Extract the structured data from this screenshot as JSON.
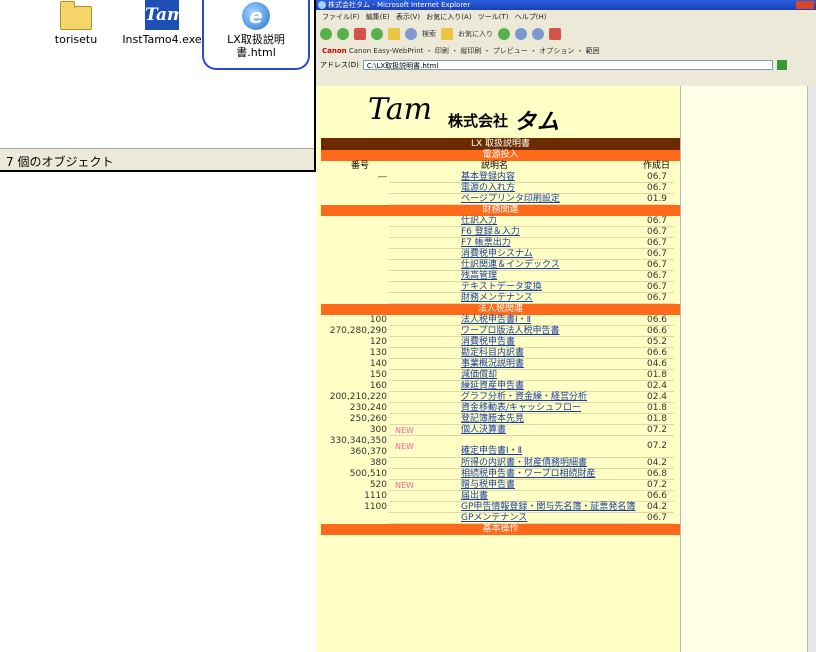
{
  "folder": {
    "icons": [
      {
        "label": "torisetu",
        "icon": "folder-icon"
      },
      {
        "label": "InstTamo4.exe",
        "icon": "tam-app-icon"
      },
      {
        "label": "LX取扱説明\n書.html",
        "icon": "ie-html-icon"
      }
    ],
    "status": "7 個のオブジェクト"
  },
  "browser": {
    "title": "株式会社タム - Microsoft Internet Explorer",
    "menu": "ファイル(F) 編集(E) 表示(V) お気に入り(A) ツール(T) ヘルプ(H)",
    "toolbar_search": "検索",
    "toolbar_favorites": "お気に入り",
    "canon_bar": "Canon Easy-WebPrint ・ 印刷 ・ 縦印刷 ・ プレビュー ・ オプション ・ 範囲",
    "address_label": "アドレス(D)",
    "address": "C:\\LX取扱説明書.html"
  },
  "page": {
    "logo_text": "am",
    "logo_company": "株式会社",
    "logo_name": "タム",
    "doc_title": "LX 取扱説明書",
    "col_number": "番号",
    "col_name": "説明名",
    "col_date": "作成日",
    "new_badge": "NEW",
    "sections": [
      {
        "title": "電源投入",
        "rows": [
          {
            "num": "―",
            "name": "基本登録内容",
            "date": "06.7"
          },
          {
            "num": "",
            "name": "電源の入れ方",
            "date": "06.7"
          },
          {
            "num": "",
            "name": "ページプリンタ印刷設定",
            "date": "01.9"
          }
        ]
      },
      {
        "title": "財務関連",
        "rows": [
          {
            "num": "",
            "name": "仕訳入力",
            "date": "06.7"
          },
          {
            "num": "",
            "name": "F6 登録＆入力",
            "date": "06.7"
          },
          {
            "num": "",
            "name": "F7 帳票出力",
            "date": "06.7"
          },
          {
            "num": "",
            "name": "消費税申シスナム",
            "date": "06.7"
          },
          {
            "num": "",
            "name": "仕訳関連＆インデックス",
            "date": "06.7"
          },
          {
            "num": "",
            "name": "残高管理",
            "date": "06.7"
          },
          {
            "num": "",
            "name": "テキストデータ変換",
            "date": "06.7"
          },
          {
            "num": "",
            "name": "財務メンテナンス",
            "date": "06.7"
          }
        ]
      },
      {
        "title": "法人税関連",
        "rows": [
          {
            "num": "100",
            "name": "法人税申告書Ⅰ・Ⅱ",
            "date": "06.6"
          },
          {
            "num": "270,280,290",
            "name": "ワープロ版法人税申告書",
            "date": "06.6"
          },
          {
            "num": "120",
            "name": "消費税申告書",
            "date": "05.2"
          },
          {
            "num": "130",
            "name": "勘定科目内訳書",
            "date": "06.6"
          },
          {
            "num": "140",
            "name": "事業概況説明書",
            "date": "04.6"
          },
          {
            "num": "150",
            "name": "減価償却",
            "date": "01.8"
          },
          {
            "num": "160",
            "name": "繰延資産申告書",
            "date": "02.4"
          },
          {
            "num": "200,210,220",
            "name": "グラフ分析・資金繰・経営分析",
            "date": "02.4"
          },
          {
            "num": "230,240",
            "name": "資金移動表/キャッシュフロー",
            "date": "01.8"
          },
          {
            "num": "250,260",
            "name": "登記簿謄本先見",
            "date": "01.8"
          },
          {
            "num": "300",
            "name": "個人決算書",
            "date": "07.2",
            "new": true
          },
          {
            "num": "330,340,350\n360,370",
            "name": "確定申告書Ⅰ・Ⅱ",
            "date": "07.2",
            "new": true,
            "tall": true
          },
          {
            "num": "380",
            "name": "所得の内訳書・財産債務明細書",
            "date": "04.2"
          },
          {
            "num": "500,510",
            "name": "相続税申告書・ワープロ相続財産",
            "date": "06.8"
          },
          {
            "num": "520",
            "name": "贈与税申告書",
            "date": "07.2",
            "new": true
          },
          {
            "num": "1110",
            "name": "届出書",
            "date": "06.6"
          },
          {
            "num": "1100",
            "name": "GP申告情報登録・関与先名簿・証票発名簿",
            "date": "04.2"
          },
          {
            "num": "",
            "name": "GPメンテナンス",
            "date": "06.7"
          }
        ]
      },
      {
        "title": "基本操作",
        "rows": []
      }
    ]
  }
}
